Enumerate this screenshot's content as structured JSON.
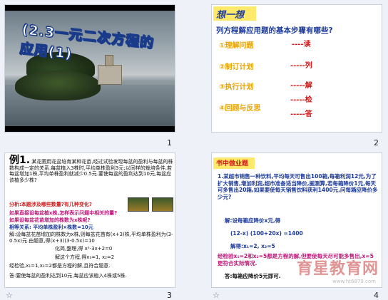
{
  "slides": [
    {
      "number": "1",
      "title": "(2.3一元二次方程的应用(1)"
    },
    {
      "number": "2",
      "heading": "想一想",
      "question": "列方程解应用题的基本步骤有哪些?",
      "steps": [
        {
          "label": "①理解问题",
          "word": "----读"
        },
        {
          "label": "②制订计划",
          "word": "-----列"
        },
        {
          "label": "③执行计划",
          "word": "-----解"
        },
        {
          "label": "④回顾与反思",
          "word": "-----检",
          "word2": "-----答"
        }
      ]
    },
    {
      "number": "3",
      "example_label": "例1.",
      "problem": "某花圃用花盆培育某种花苗,经过试验发现每盆的盈利与每盆的株数构成一定的关系.每盆植入3株时,平均单株盈利3元;以同样的栽培条件,若每盆增加1株,平均单株盈利就减少0.5元.要使每盆的盈利达到10元,每盆应该植多少株?",
      "analysis_q": "分析:本题涉及哪些数量?有几种变化?",
      "analysis_1": "如果直接设每盆植x株,怎样表示问题中相关的量?",
      "analysis_2": "如果设每盆花苗增加的株数为x株呢?",
      "analysis_3": "相等关系:      平均单株盈利×株数=10元",
      "solution_1": "解:设每盆花苗增加的株数为x株,则每盆花苗有(x+3)株,平均单株盈利为(3-0.5x)元.由题意,得(x+3)(3-0.5x)=10",
      "solution_2": "化简,整理,得 x²-3x+2=0",
      "solution_3": "解这个方程,得x₁=1, x₂=2",
      "check": "经检验,x₁=1,x₂=2都是方程的解,且符合题意.",
      "answer": "答:要使每盆的盈利达到10元,每盆应该植入4株或5株."
    },
    {
      "number": "4",
      "heading": "书中做业题",
      "problem": "1.某超市销售一种饮料,平均每天可售出100箱,每箱利润12元,为了扩大销售,增加利润,超市准备适当降价,据测算,若每箱降价1元,每天可多售出20箱,如果要使每天销售饮料获利1400元,问每箱应降价多少元?",
      "solution_1": "解:设每箱应降价x元,得",
      "solution_2": "(12-x)    (100+20x)  =1400",
      "solution_3": "解得:x₁=2,  x₂=5",
      "check": "经检验x₁=2和x₂=5都是方程的解,但要使每天尽可能多售出,x=5更符合实际情况.",
      "answer": "答:每箱应降价5元即可.",
      "watermark": "育星教育网",
      "watermark_url": "www.ht6879.com"
    }
  ]
}
